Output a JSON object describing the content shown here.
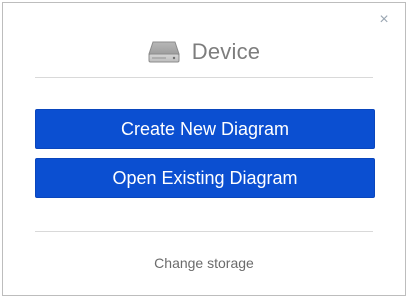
{
  "dialog": {
    "title": "Device",
    "close_symbol": "×",
    "icon": "hard-drive-icon"
  },
  "actions": {
    "create_label": "Create New Diagram",
    "open_label": "Open Existing Diagram"
  },
  "footer": {
    "change_storage_label": "Change storage"
  },
  "colors": {
    "primary_button": "#0b4fd1",
    "title_text": "#7d7d7d",
    "divider": "#d9d9d9"
  }
}
